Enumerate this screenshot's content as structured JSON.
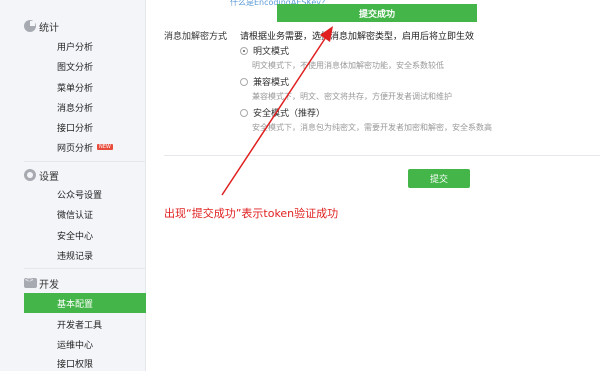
{
  "sidebar": {
    "sections": [
      {
        "title": "统计",
        "icon": "pie-chart-icon",
        "items": [
          "用户分析",
          "图文分析",
          "菜单分析",
          "消息分析",
          "接口分析",
          "网页分析"
        ]
      },
      {
        "title": "设置",
        "icon": "gear-icon",
        "items": [
          "公众号设置",
          "微信认证",
          "安全中心",
          "违规记录"
        ]
      },
      {
        "title": "开发",
        "icon": "code-icon",
        "items": [
          "基本配置",
          "开发者工具",
          "运维中心",
          "接口权限"
        ]
      }
    ],
    "new_badge": "NEW",
    "active_item": "基本配置"
  },
  "main": {
    "top_link": "什么是EncodingAESKey?",
    "toast": "提交成功",
    "field_label": "消息加解密方式",
    "field_desc": "请根据业务需要，选择消息加解密类型，启用后将立即生效",
    "options": [
      {
        "label": "明文模式",
        "desc": "明文模式下，不使用消息体加解密功能，安全系数较低",
        "checked": true
      },
      {
        "label": "兼容模式",
        "desc": "兼容模式下，明文、密文将共存，方便开发者调试和维护",
        "checked": false
      },
      {
        "label": "安全模式（推荐）",
        "desc": "安全模式下，消息包为纯密文，需要开发者加密和解密，安全系数高",
        "checked": false
      }
    ],
    "submit_label": "提交"
  },
  "annotation": {
    "text": "出现“提交成功”表示token验证成功",
    "color": "#e02020"
  },
  "colors": {
    "accent": "#44b549",
    "sidebar_bg": "#f4f5f9"
  }
}
